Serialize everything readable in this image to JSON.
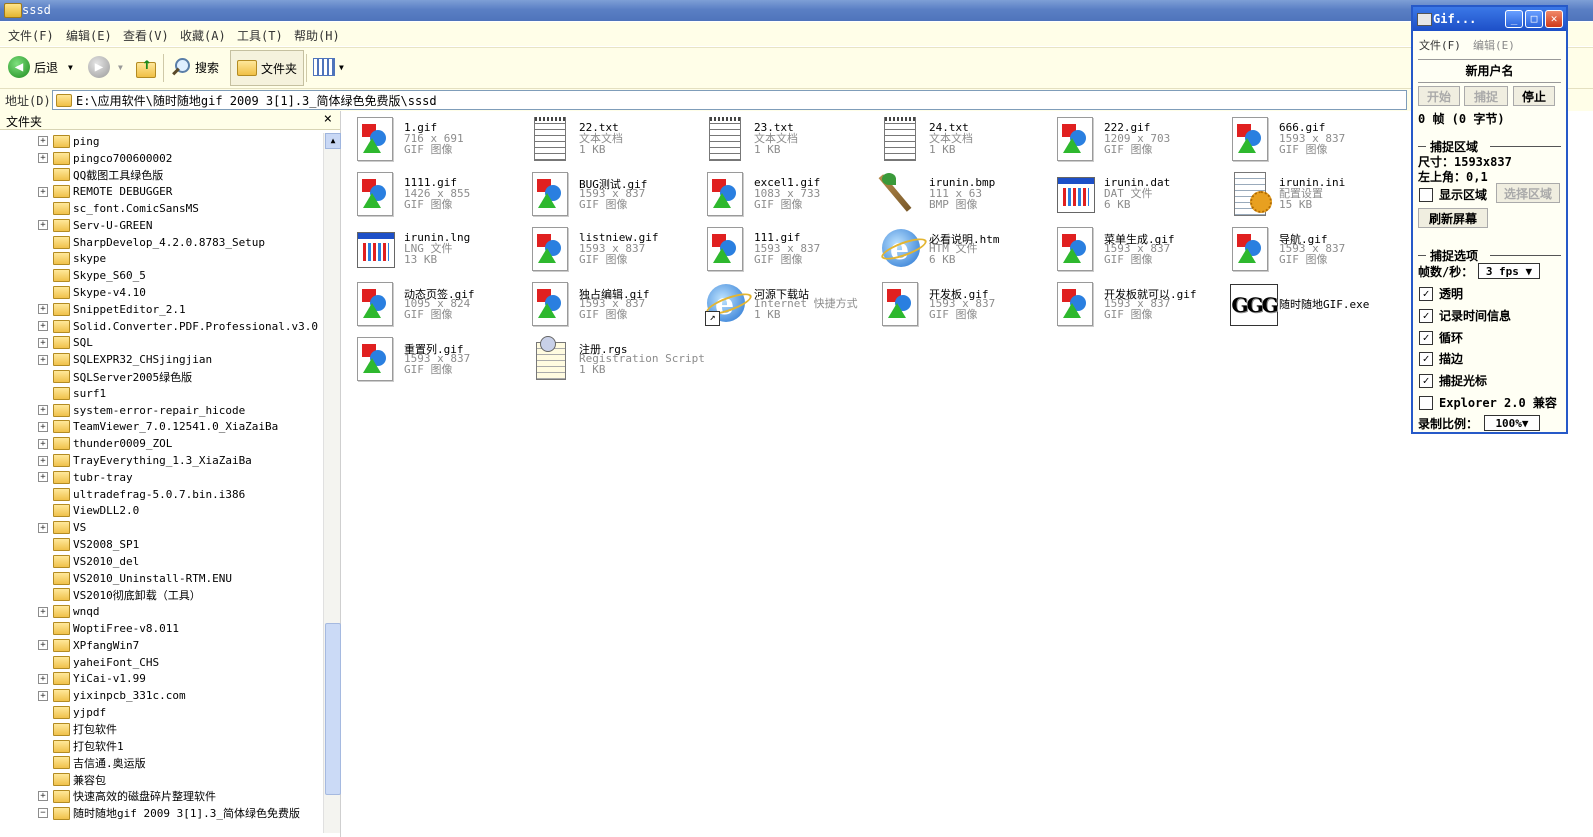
{
  "window": {
    "title": "sssd"
  },
  "menu": [
    "文件(F)",
    "编辑(E)",
    "查看(V)",
    "收藏(A)",
    "工具(T)",
    "帮助(H)"
  ],
  "toolbar": {
    "back": "后退",
    "search": "搜索",
    "folders": "文件夹"
  },
  "address": {
    "label": "地址(D)",
    "path": "E:\\应用软件\\随时随地gif 2009 3[1].3_简体绿色免费版\\sssd"
  },
  "tree": {
    "header": "文件夹",
    "close": "×",
    "items": [
      {
        "label": "ping",
        "expand": "+"
      },
      {
        "label": "pingco700600002",
        "expand": "+"
      },
      {
        "label": "QQ截图工具绿色版",
        "expand": ""
      },
      {
        "label": "REMOTE DEBUGGER",
        "expand": "+"
      },
      {
        "label": "sc_font.ComicSansMS",
        "expand": ""
      },
      {
        "label": "Serv-U-GREEN",
        "expand": "+"
      },
      {
        "label": "SharpDevelop_4.2.0.8783_Setup",
        "expand": ""
      },
      {
        "label": "skype",
        "expand": ""
      },
      {
        "label": "Skype_S60_5",
        "expand": ""
      },
      {
        "label": "Skype-v4.10",
        "expand": ""
      },
      {
        "label": "SnippetEditor_2.1",
        "expand": "+"
      },
      {
        "label": "Solid.Converter.PDF.Professional.v3.0",
        "expand": "+"
      },
      {
        "label": "SQL",
        "expand": "+"
      },
      {
        "label": "SQLEXPR32_CHSjingjian",
        "expand": "+"
      },
      {
        "label": "SQLServer2005绿色版",
        "expand": ""
      },
      {
        "label": "surf1",
        "expand": ""
      },
      {
        "label": "system-error-repair_hicode",
        "expand": "+"
      },
      {
        "label": "TeamViewer_7.0.12541.0_XiaZaiBa",
        "expand": "+"
      },
      {
        "label": "thunder0009_ZOL",
        "expand": "+"
      },
      {
        "label": "TrayEverything_1.3_XiaZaiBa",
        "expand": "+"
      },
      {
        "label": "tubr-tray",
        "expand": "+"
      },
      {
        "label": "ultradefrag-5.0.7.bin.i386",
        "expand": ""
      },
      {
        "label": "ViewDLL2.0",
        "expand": ""
      },
      {
        "label": "VS",
        "expand": "+"
      },
      {
        "label": "VS2008_SP1",
        "expand": ""
      },
      {
        "label": "VS2010_del",
        "expand": ""
      },
      {
        "label": "VS2010_Uninstall-RTM.ENU",
        "expand": ""
      },
      {
        "label": "VS2010彻底卸载（工具）",
        "expand": ""
      },
      {
        "label": "wnqd",
        "expand": "+"
      },
      {
        "label": "WoptiFree-v8.011",
        "expand": ""
      },
      {
        "label": "XPfangWin7",
        "expand": "+"
      },
      {
        "label": "yaheiFont_CHS",
        "expand": ""
      },
      {
        "label": "YiCai-v1.99",
        "expand": "+"
      },
      {
        "label": "yixinpcb_331c.com",
        "expand": "+"
      },
      {
        "label": "yjpdf",
        "expand": ""
      },
      {
        "label": "打包软件",
        "expand": ""
      },
      {
        "label": "打包软件1",
        "expand": ""
      },
      {
        "label": "吉信通.奥运版",
        "expand": ""
      },
      {
        "label": "兼容包",
        "expand": ""
      },
      {
        "label": "快速高效的磁盘碎片整理软件",
        "expand": "+"
      },
      {
        "label": "随时随地gif 2009 3[1].3_简体绿色免费版",
        "expand": "−"
      }
    ]
  },
  "files": [
    {
      "name": "1.gif",
      "l1": "716 x 691",
      "l2": "GIF 图像",
      "icon": "gif-image-icon"
    },
    {
      "name": "22.txt",
      "l1": "文本文档",
      "l2": "1 KB",
      "icon": "text-file-icon"
    },
    {
      "name": "23.txt",
      "l1": "文本文档",
      "l2": "1 KB",
      "icon": "text-file-icon"
    },
    {
      "name": "24.txt",
      "l1": "文本文档",
      "l2": "1 KB",
      "icon": "text-file-icon"
    },
    {
      "name": "222.gif",
      "l1": "1209 x 703",
      "l2": "GIF 图像",
      "icon": "gif-image-icon"
    },
    {
      "name": "666.gif",
      "l1": "1593 x 837",
      "l2": "GIF 图像",
      "icon": "gif-image-icon"
    },
    {
      "name": "1111.gif",
      "l1": "1426 x 855",
      "l2": "GIF 图像",
      "icon": "gif-image-icon"
    },
    {
      "name": "BUG测试.gif",
      "l1": "1593 x 837",
      "l2": "GIF 图像",
      "icon": "gif-image-icon"
    },
    {
      "name": "excel1.gif",
      "l1": "1083 x 733",
      "l2": "GIF 图像",
      "icon": "gif-image-icon"
    },
    {
      "name": "irunin.bmp",
      "l1": "111 x 63",
      "l2": "BMP 图像",
      "icon": "paintbrush-icon"
    },
    {
      "name": "irunin.dat",
      "l1": "DAT 文件",
      "l2": "6 KB",
      "icon": "dat-file-icon"
    },
    {
      "name": "irunin.ini",
      "l1": "配置设置",
      "l2": "15 KB",
      "icon": "settings-file-icon"
    },
    {
      "name": "irunin.lng",
      "l1": "LNG 文件",
      "l2": "13 KB",
      "icon": "dat-file-icon"
    },
    {
      "name": "listniew.gif",
      "l1": "1593 x 837",
      "l2": "GIF 图像",
      "icon": "gif-image-icon"
    },
    {
      "name": "111.gif",
      "l1": "1593 x 837",
      "l2": "GIF 图像",
      "icon": "gif-image-icon"
    },
    {
      "name": "必看说明.htm",
      "l1": "HTM 文件",
      "l2": "6 KB",
      "icon": "ie-icon"
    },
    {
      "name": "菜单生成.gif",
      "l1": "1593 x 837",
      "l2": "GIF 图像",
      "icon": "gif-image-icon"
    },
    {
      "name": "导航.gif",
      "l1": "1593 x 837",
      "l2": "GIF 图像",
      "icon": "gif-image-icon"
    },
    {
      "name": "动态页签.gif",
      "l1": "1095 x 824",
      "l2": "GIF 图像",
      "icon": "gif-image-icon"
    },
    {
      "name": "独占编辑.gif",
      "l1": "1593 x 837",
      "l2": "GIF 图像",
      "icon": "gif-image-icon"
    },
    {
      "name": "河源下载站",
      "l1": "Internet 快捷方式",
      "l2": "1 KB",
      "icon": "ie-shortcut-icon"
    },
    {
      "name": "开发板.gif",
      "l1": "1593 x 837",
      "l2": "GIF 图像",
      "icon": "gif-image-icon"
    },
    {
      "name": "开发板就可以.gif",
      "l1": "1593 x 837",
      "l2": "GIF 图像",
      "icon": "gif-image-icon"
    },
    {
      "name": "随时随地GIF.exe",
      "l1": "",
      "l2": "",
      "icon": "gif-app-icon"
    },
    {
      "name": "重置列.gif",
      "l1": "1593 x 837",
      "l2": "GIF 图像",
      "icon": "gif-image-icon"
    },
    {
      "name": "注册.rgs",
      "l1": "Registration Script",
      "l2": "1 KB",
      "icon": "script-file-icon"
    }
  ],
  "gif": {
    "title": "Gif...",
    "menu": [
      "文件(F)",
      "编辑(E)"
    ],
    "user": "新用户名",
    "start": "开始",
    "capture": "捕捉",
    "stop": "停止",
    "frames": "0 帧 (0 字节)",
    "region_title": "捕捉区域",
    "size": "尺寸：1593x837",
    "topleft": "左上角：0,1",
    "show_region": "显示区域",
    "select_region": "选择区域",
    "refresh": "刷新屏幕",
    "options_title": "捕捉选项",
    "fps_label": "帧数/秒：",
    "fps_value": "3 fps ▼",
    "transparent": "透明",
    "record_time": "记录时间信息",
    "loop": "循环",
    "border": "描边",
    "capture_cursor": "捕捉光标",
    "explorer_compat": "Explorer 2.0 兼容",
    "ratio_label": "录制比例：",
    "ratio_value": "100%▼"
  }
}
